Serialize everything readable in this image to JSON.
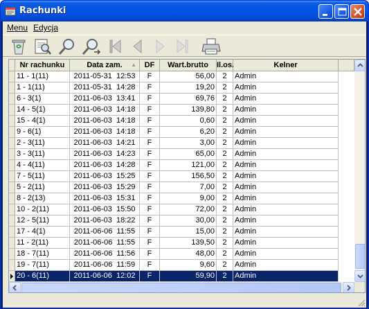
{
  "window": {
    "title": "Rachunki"
  },
  "menu": {
    "items": [
      {
        "label": "Menu"
      },
      {
        "label": "Edycja"
      }
    ]
  },
  "toolbar": {
    "icons": [
      "trash-icon",
      "preview-icon",
      "search-icon",
      "search-next-icon",
      "first-record-icon",
      "prev-record-icon",
      "next-record-icon",
      "last-record-icon",
      "print-icon"
    ]
  },
  "table": {
    "columns": [
      "Nr rachunku",
      "Data zam.",
      "DF",
      "Wart.brutto",
      "Il.os.",
      "Kelner"
    ],
    "sort_indicator": "▲",
    "rows": [
      [
        "11 - 1(11)",
        "2011-05-31  12:53",
        "F",
        "56,00",
        "2",
        "Admin"
      ],
      [
        "1 - 1(11)",
        "2011-05-31  14:28",
        "F",
        "19,20",
        "2",
        "Admin"
      ],
      [
        "6 - 3(1)",
        "2011-06-03  13:41",
        "F",
        "69,76",
        "2",
        "Admin"
      ],
      [
        "14 - 5(1)",
        "2011-06-03  14:18",
        "F",
        "139,80",
        "2",
        "Admin"
      ],
      [
        "15 - 4(1)",
        "2011-06-03  14:18",
        "F",
        "0,60",
        "2",
        "Admin"
      ],
      [
        "9 - 6(1)",
        "2011-06-03  14:18",
        "F",
        "6,20",
        "2",
        "Admin"
      ],
      [
        "2 - 3(11)",
        "2011-06-03  14:21",
        "F",
        "3,00",
        "2",
        "Admin"
      ],
      [
        "3 - 3(11)",
        "2011-06-03  14:23",
        "F",
        "65,00",
        "2",
        "Admin"
      ],
      [
        "4 - 4(11)",
        "2011-06-03  14:28",
        "F",
        "121,00",
        "2",
        "Admin"
      ],
      [
        "7 - 5(11)",
        "2011-06-03  15:25",
        "F",
        "156,50",
        "2",
        "Admin"
      ],
      [
        "5 - 2(11)",
        "2011-06-03  15:29",
        "F",
        "7,00",
        "2",
        "Admin"
      ],
      [
        "8 - 2(13)",
        "2011-06-03  15:31",
        "F",
        "9,00",
        "2",
        "Admin"
      ],
      [
        "10 - 2(11)",
        "2011-06-03  15:50",
        "F",
        "72,00",
        "2",
        "Admin"
      ],
      [
        "12 - 5(11)",
        "2011-06-03  18:22",
        "F",
        "30,00",
        "2",
        "Admin"
      ],
      [
        "17 - 4(1)",
        "2011-06-06  11:55",
        "F",
        "15,00",
        "2",
        "Admin"
      ],
      [
        "11 - 2(11)",
        "2011-06-06  11:55",
        "F",
        "139,50",
        "2",
        "Admin"
      ],
      [
        "18 - 7(11)",
        "2011-06-06  11:56",
        "F",
        "48,00",
        "2",
        "Admin"
      ],
      [
        "19 - 7(11)",
        "2011-06-06  11:59",
        "F",
        "9,60",
        "2",
        "Admin"
      ],
      [
        "20 - 6(11)",
        "2011-06-06  12:02",
        "F",
        "59,90",
        "2",
        "Admin"
      ]
    ],
    "selected_row": 18
  },
  "colors": {
    "selection": "#0a246a",
    "title_bar": "#0054e3"
  }
}
